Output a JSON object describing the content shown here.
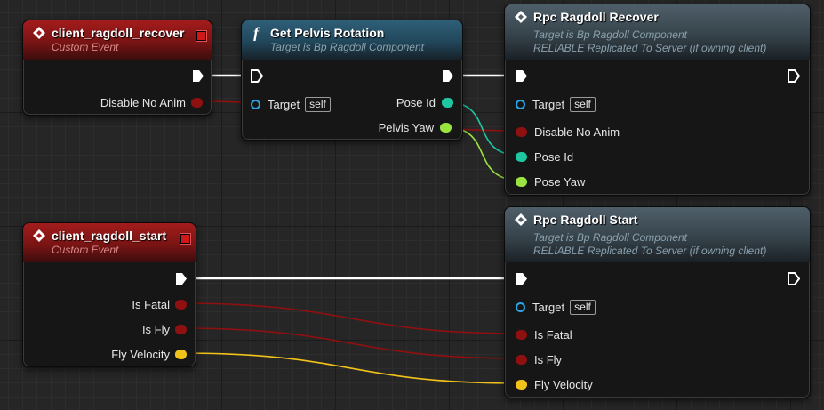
{
  "colors": {
    "exec": "#ffffff",
    "bool": "#8e1010",
    "object_ref": "#2aa6e8",
    "byte_enum": "#1ec7a2",
    "float": "#9be33f",
    "vector": "#f1c21a",
    "event_header": "#a31c1c",
    "function_header": "#2f5f78",
    "rpc_header": "#4f5f69"
  },
  "nodes": {
    "recover_event": {
      "title": "client_ragdoll_recover",
      "subtitle": "Custom Event",
      "pins": {
        "disable_no_anim": "Disable No Anim"
      }
    },
    "get_pelvis": {
      "title": "Get Pelvis Rotation",
      "subtitle": "Target is Bp Ragdoll Component",
      "pins": {
        "target": "Target",
        "target_default": "self",
        "pose_id": "Pose Id",
        "pelvis_yaw": "Pelvis Yaw"
      }
    },
    "rpc_recover": {
      "title": "Rpc Ragdoll Recover",
      "subtitle1": "Target is Bp Ragdoll Component",
      "subtitle2": "RELIABLE Replicated To Server (if owning client)",
      "pins": {
        "target": "Target",
        "target_default": "self",
        "disable_no_anim": "Disable No Anim",
        "pose_id": "Pose Id",
        "pose_yaw": "Pose Yaw"
      }
    },
    "start_event": {
      "title": "client_ragdoll_start",
      "subtitle": "Custom Event",
      "pins": {
        "is_fatal": "Is Fatal",
        "is_fly": "Is Fly",
        "fly_velocity": "Fly Velocity"
      }
    },
    "rpc_start": {
      "title": "Rpc Ragdoll Start",
      "subtitle1": "Target is Bp Ragdoll Component",
      "subtitle2": "RELIABLE Replicated To Server (if owning client)",
      "pins": {
        "target": "Target",
        "target_default": "self",
        "is_fatal": "Is Fatal",
        "is_fly": "Is Fly",
        "fly_velocity": "Fly Velocity"
      }
    }
  },
  "icons": {
    "event": "event-diamond-icon",
    "function": "function-f-icon",
    "exec": "exec-arrow-icon"
  }
}
